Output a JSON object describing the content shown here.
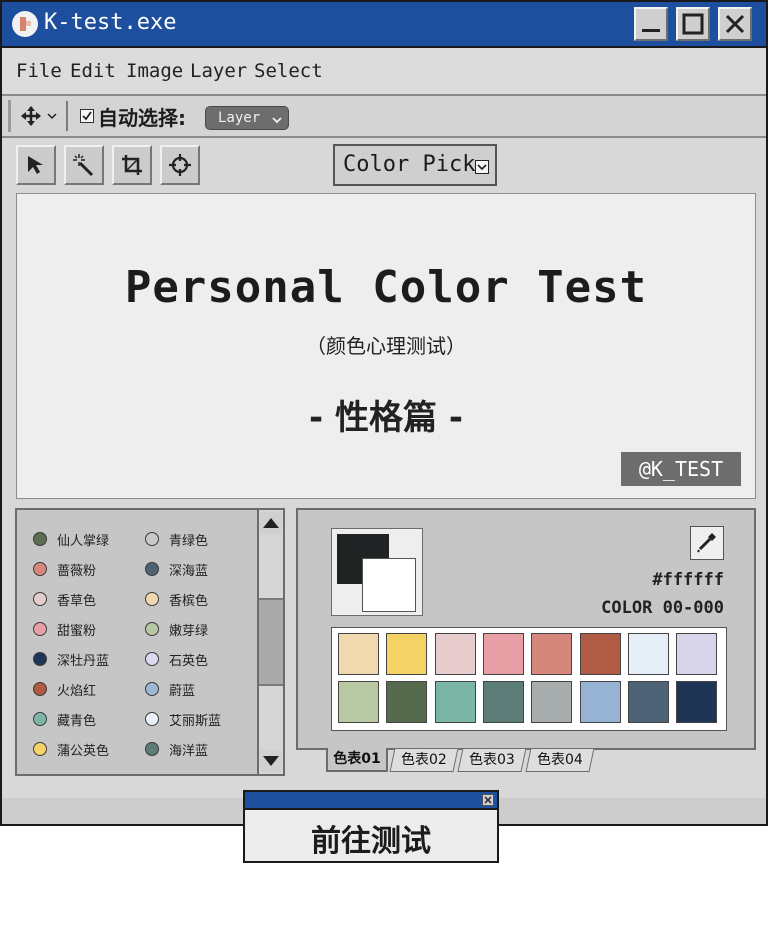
{
  "window": {
    "title": "K-test.exe"
  },
  "menu": [
    "File",
    "Edit",
    "Image",
    "Layer",
    "Select"
  ],
  "options": {
    "auto_select_label": "自动选择:",
    "layer_dropdown": "Layer"
  },
  "tool_mode": {
    "label": "Color Pick"
  },
  "canvas": {
    "title": "Personal Color Test",
    "subtitle": "（颜色心理测试）",
    "part": "- 性格篇 -",
    "handle": "@K_TEST"
  },
  "color_list": [
    {
      "name": "仙人掌绿",
      "color": "#5b6e52"
    },
    {
      "name": "青绿色",
      "color": "#c9c9c9"
    },
    {
      "name": "蔷薇粉",
      "color": "#d4877a"
    },
    {
      "name": "深海蓝",
      "color": "#4e6376"
    },
    {
      "name": "香草色",
      "color": "#e6cccc"
    },
    {
      "name": "香槟色",
      "color": "#f0d9ae"
    },
    {
      "name": "甜蜜粉",
      "color": "#e89ea5"
    },
    {
      "name": "嫩芽绿",
      "color": "#b8c8a2"
    },
    {
      "name": "深牡丹蓝",
      "color": "#1f3556"
    },
    {
      "name": "石英色",
      "color": "#dcdaf0"
    },
    {
      "name": "火焰红",
      "color": "#b05c44"
    },
    {
      "name": "蔚蓝",
      "color": "#9db6d6"
    },
    {
      "name": "藏青色",
      "color": "#7ab5a5"
    },
    {
      "name": "艾丽斯蓝",
      "color": "#eaf0f8"
    },
    {
      "name": "蒲公英色",
      "color": "#f5d266"
    },
    {
      "name": "海洋蓝",
      "color": "#5c7c78"
    }
  ],
  "palette": {
    "hex": "#ffffff",
    "code": "COLOR 00-000",
    "foreground": "#1f2323",
    "background": "#ffffff",
    "swatches": [
      "#f0d9ae",
      "#f5d266",
      "#e6cccc",
      "#e89ea5",
      "#d4877a",
      "#b05c44",
      "#e6eef8",
      "#d8d4ea",
      "#b8c8a2",
      "#566b4e",
      "#7ab5a5",
      "#5c7c78",
      "#a8adae",
      "#97b3d4",
      "#4e6376",
      "#1f3556"
    ],
    "tabs": [
      "色表01",
      "色表02",
      "色表03",
      "色表04"
    ]
  },
  "popup": {
    "label": "前往测试"
  }
}
